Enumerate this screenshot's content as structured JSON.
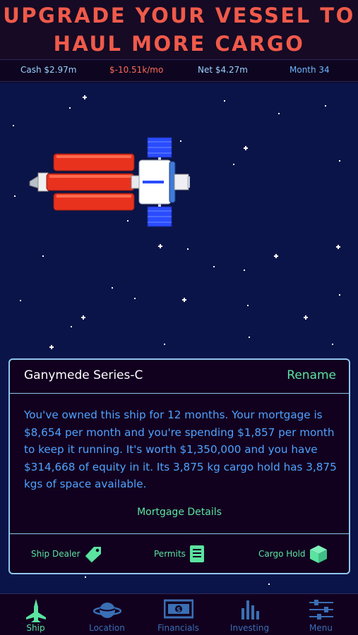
{
  "banner": {
    "line1": "UPGRADE YOUR VESSEL TO",
    "line2": "HAUL MORE CARGO"
  },
  "stats": {
    "cash": "Cash $2.97m",
    "burn": "$-10.51k/mo",
    "net": "Net $4.27m",
    "month": "Month 34"
  },
  "ship_panel": {
    "name": "Ganymede Series-C",
    "rename_label": "Rename",
    "description": "You've owned this ship for 12 months. Your mortgage is $8,654 per month and you're spending $1,857 per month to keep it running. It's worth $1,350,000 and you have $314,668 of equity in it. Its 3,875 kg cargo hold has 3,875 kgs of space available.",
    "mortgage_link": "Mortgage Details",
    "actions": [
      {
        "label": "Ship Dealer",
        "icon": "tag-icon"
      },
      {
        "label": "Permits",
        "icon": "document-icon"
      },
      {
        "label": "Cargo Hold",
        "icon": "cube-icon"
      }
    ]
  },
  "tabs": [
    {
      "label": "Ship",
      "icon": "jet-icon",
      "active": true
    },
    {
      "label": "Location",
      "icon": "planet-icon",
      "active": false
    },
    {
      "label": "Financials",
      "icon": "banknote-icon",
      "active": false
    },
    {
      "label": "Investing",
      "icon": "bar-chart-icon",
      "active": false
    },
    {
      "label": "Menu",
      "icon": "sliders-icon",
      "active": false
    }
  ],
  "colors": {
    "banner_text": "#f05a4a",
    "accent_green": "#5be3a0",
    "text_blue": "#4ea3ff",
    "space_bg": "#0a1448",
    "panel_border": "#8fc6ec"
  }
}
